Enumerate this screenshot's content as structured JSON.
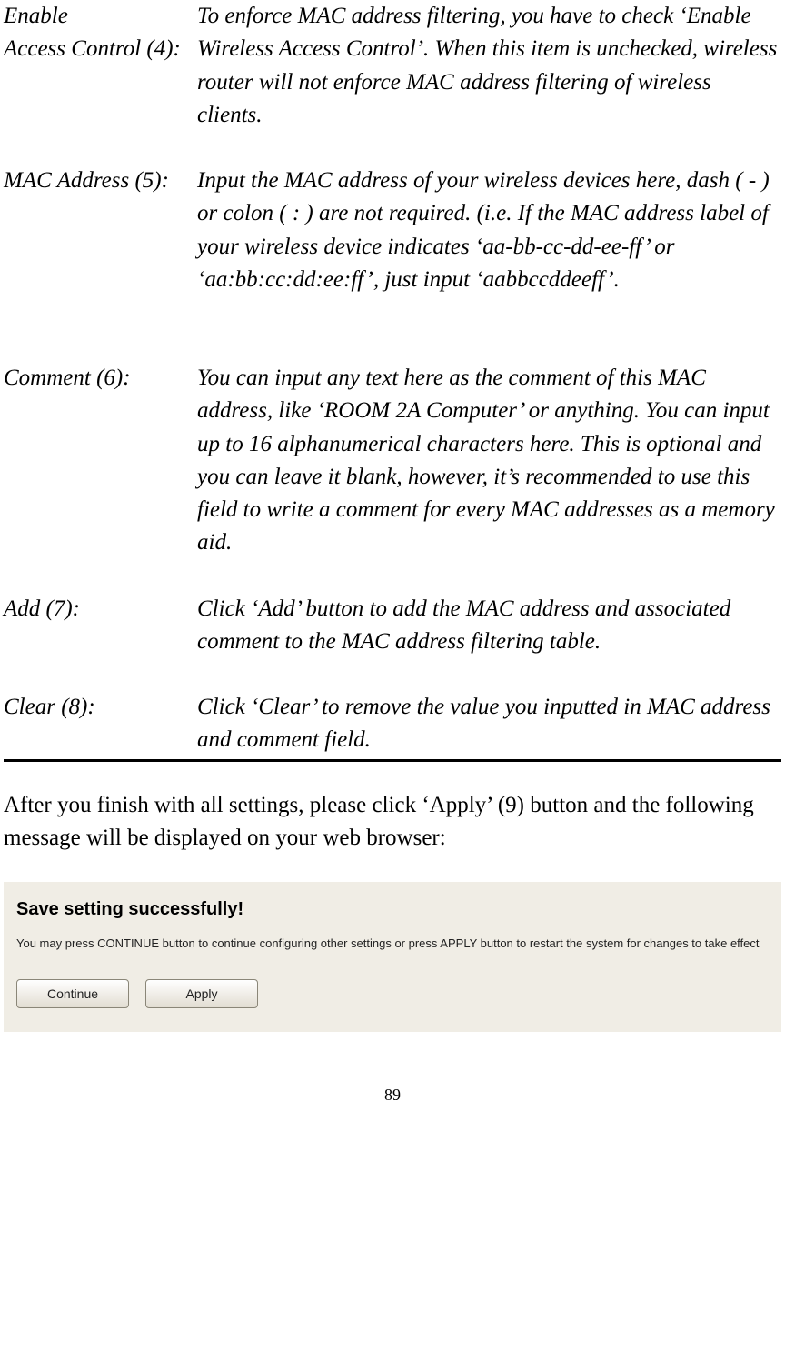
{
  "definitions": [
    {
      "term_lines": [
        "Enable",
        "Access Control (4):"
      ],
      "desc": "To enforce MAC address filtering, you have to check ‘Enable Wireless Access Control’. When this item is unchecked, wireless router will not enforce MAC address filtering of wireless clients."
    },
    {
      "term_lines": [
        "MAC Address (5):"
      ],
      "desc": "Input the MAC address of your wireless devices here, dash ( - ) or colon ( : ) are not required. (i.e. If the MAC address label of your wireless device indicates ‘aa-bb-cc-dd-ee-ff’ or ‘aa:bb:cc:dd:ee:ff’, just input ‘aabbccddeeff’."
    },
    {
      "term_lines": [
        "Comment (6):"
      ],
      "desc": "You can input any text here as the comment of this MAC address, like ‘ROOM 2A Computer’ or anything. You can input up to 16 alphanumerical characters here. This is optional and you can leave it blank, however, it’s recommended to use this field to write a comment for every MAC addresses as a memory aid."
    },
    {
      "term_lines": [
        "Add (7):"
      ],
      "desc": "Click ‘Add’ button to add the MAC address and associated comment to the MAC address filtering table."
    },
    {
      "term_lines": [
        "Clear (8):"
      ],
      "desc": "Click ‘Clear’ to remove the value you inputted in MAC address and comment field."
    }
  ],
  "after_text": "After you finish with all settings, please click ‘Apply’ (9) button and the following message will be displayed on your web browser:",
  "browser": {
    "title": "Save setting successfully!",
    "desc": "You may press CONTINUE button to continue configuring other settings or press APPLY button to restart the system for changes to take effect",
    "continue_label": "Continue",
    "apply_label": "Apply"
  },
  "page_number": "89"
}
